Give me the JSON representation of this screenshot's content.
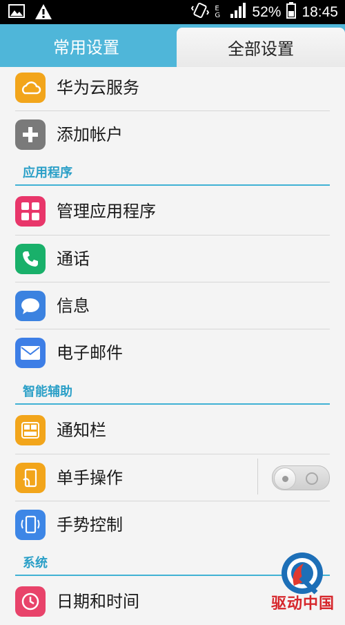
{
  "status_bar": {
    "battery": "52%",
    "time": "18:45",
    "network": "E G",
    "icons": [
      "image-icon",
      "warning-icon",
      "vibrate-icon",
      "signal-icon",
      "battery-icon"
    ]
  },
  "tabs": {
    "common": "常用设置",
    "all": "全部设置"
  },
  "items": {
    "cloud": "华为云服务",
    "add_account": "添加帐户",
    "manage_apps": "管理应用程序",
    "calls": "通话",
    "messages": "信息",
    "email": "电子邮件",
    "notification_bar": "通知栏",
    "one_hand": "单手操作",
    "gesture": "手势控制",
    "datetime": "日期和时间"
  },
  "sections": {
    "apps": "应用程序",
    "smart": "智能辅助",
    "system": "系统"
  },
  "toggles": {
    "one_hand": "off"
  },
  "watermark": {
    "text": "驱动中国"
  },
  "colors": {
    "tab_bar": "#4fb6d9",
    "accent": "#3fb1d4",
    "section_text": "#2a9fc7"
  }
}
